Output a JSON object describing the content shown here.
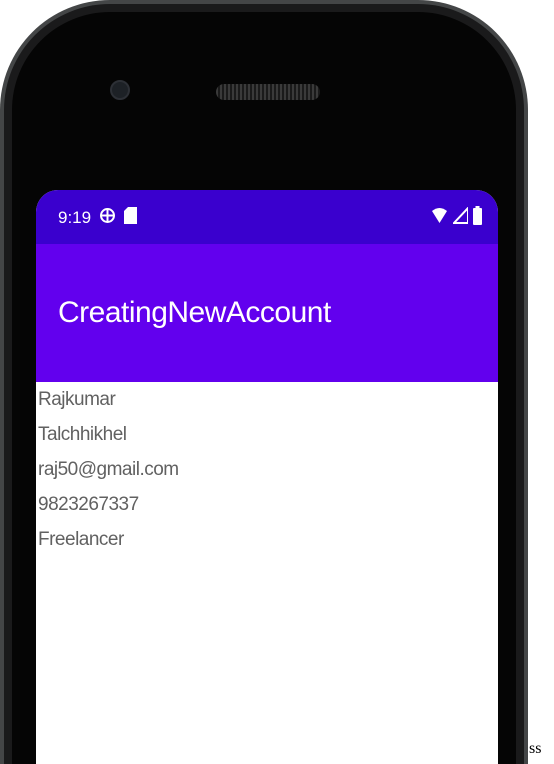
{
  "status_bar": {
    "time": "9:19",
    "left_icons": [
      "vpn-globe-icon",
      "sd-card-icon"
    ],
    "right_icons": [
      "wifi-icon",
      "cell-signal-icon",
      "battery-icon"
    ]
  },
  "app_bar": {
    "title": "CreatingNewAccount"
  },
  "fields": [
    {
      "value": "Rajkumar"
    },
    {
      "value": "Talchhikhel"
    },
    {
      "value": "raj50@gmail.com"
    },
    {
      "value": "9823267337"
    },
    {
      "value": "Freelancer"
    }
  ],
  "side_text": "ss",
  "colors": {
    "status_bar": "#3a00ce",
    "app_bar": "#6200ee",
    "field_text": "#616161",
    "phone_bezel": "#050505"
  }
}
